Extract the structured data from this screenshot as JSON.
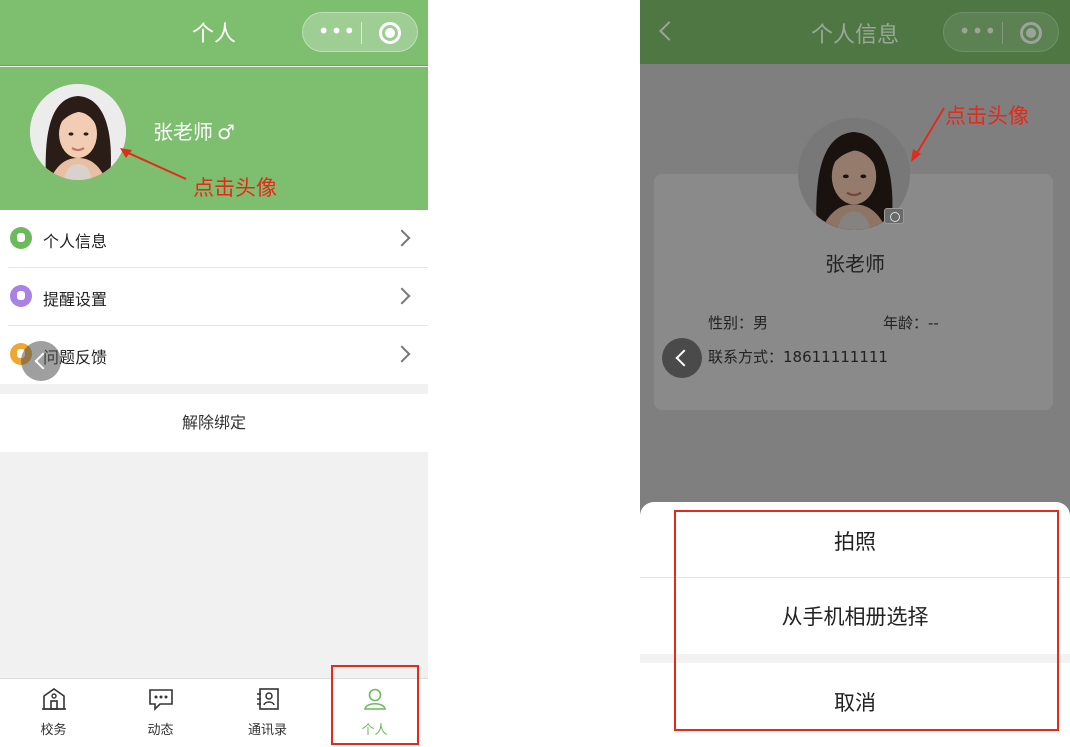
{
  "left": {
    "header": {
      "title": "个人",
      "more_glyph": "•••"
    },
    "profile": {
      "name": "张老师",
      "gender_symbol": "♂"
    },
    "annotation": "点击头像",
    "menu": [
      {
        "label": "个人信息",
        "icon": "person-icon",
        "color": "#6cba5d"
      },
      {
        "label": "提醒设置",
        "icon": "bell-icon",
        "color": "#a882e4"
      },
      {
        "label": "问题反馈",
        "icon": "feedback-icon",
        "color": "#f0a732"
      }
    ],
    "unbind_label": "解除绑定",
    "tabs": [
      {
        "label": "校务",
        "icon": "school-icon"
      },
      {
        "label": "动态",
        "icon": "chat-icon"
      },
      {
        "label": "通讯录",
        "icon": "contacts-icon"
      },
      {
        "label": "个人",
        "icon": "user-icon",
        "active": true
      }
    ]
  },
  "right": {
    "header": {
      "title": "个人信息",
      "more_glyph": "•••"
    },
    "annotation": "点击头像",
    "name": "张老师",
    "gender": "性别：男",
    "age": "年龄：--",
    "phone": "联系方式：18611111111",
    "sheet": {
      "take_photo": "拍照",
      "choose_album": "从手机相册选择",
      "cancel": "取消"
    }
  },
  "colors": {
    "brand_green": "#7ebe6f",
    "annotation_red": "#e42a1a"
  }
}
